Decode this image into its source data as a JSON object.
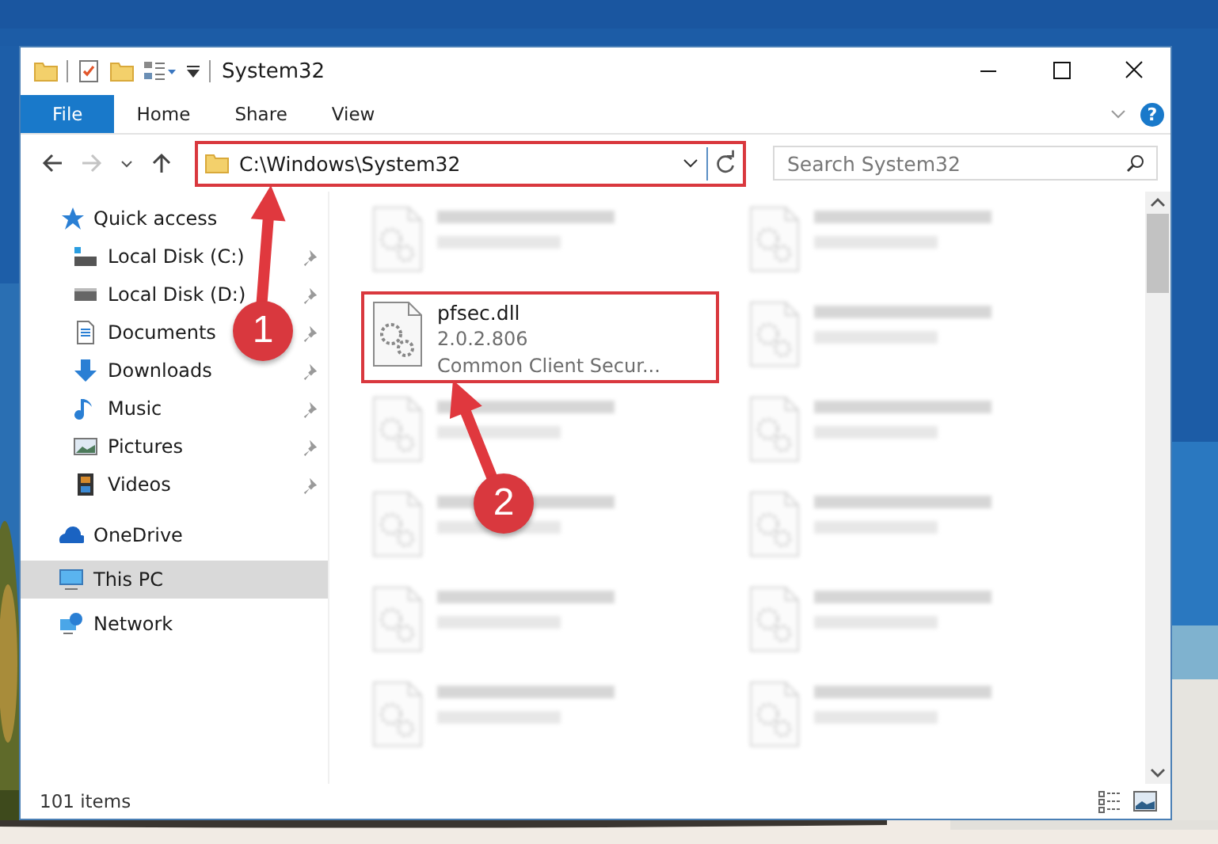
{
  "window": {
    "title": "System32"
  },
  "ribbon": {
    "tabs": [
      {
        "label": "File",
        "selected": true
      },
      {
        "label": "Home",
        "selected": false
      },
      {
        "label": "Share",
        "selected": false
      },
      {
        "label": "View",
        "selected": false
      }
    ],
    "help": "?"
  },
  "address": {
    "path": "C:\\Windows\\System32",
    "highlighted": true,
    "forward_disabled": true
  },
  "search": {
    "placeholder": "Search System32"
  },
  "sidebar": {
    "items": [
      {
        "label": "Quick access",
        "kind": "quick",
        "pinned": false,
        "selected": false,
        "group": true
      },
      {
        "label": "Local Disk (C:)",
        "kind": "system-disk",
        "pinned": true,
        "selected": false,
        "group": false
      },
      {
        "label": "Local Disk (D:)",
        "kind": "disk",
        "pinned": true,
        "selected": false,
        "group": false
      },
      {
        "label": "Documents",
        "kind": "documents",
        "pinned": true,
        "selected": false,
        "group": false
      },
      {
        "label": "Downloads",
        "kind": "downloads",
        "pinned": true,
        "selected": false,
        "group": false
      },
      {
        "label": "Music",
        "kind": "music",
        "pinned": true,
        "selected": false,
        "group": false
      },
      {
        "label": "Pictures",
        "kind": "pictures",
        "pinned": true,
        "selected": false,
        "group": false
      },
      {
        "label": "Videos",
        "kind": "videos",
        "pinned": true,
        "selected": false,
        "group": false
      },
      {
        "label": "OneDrive",
        "kind": "cloud",
        "pinned": false,
        "selected": false,
        "group": true
      },
      {
        "label": "This PC",
        "kind": "pc",
        "pinned": false,
        "selected": true,
        "group": true
      },
      {
        "label": "Network",
        "kind": "network",
        "pinned": false,
        "selected": false,
        "group": true
      }
    ]
  },
  "files": [
    {
      "blurred": true,
      "highlighted": false
    },
    {
      "blurred": true,
      "highlighted": false
    },
    {
      "name": "pfsec.dll",
      "lines": [
        "2.0.2.806",
        "Common Client Secur..."
      ],
      "blurred": false,
      "highlighted": true
    },
    {
      "blurred": true,
      "highlighted": false
    },
    {
      "blurred": true,
      "highlighted": false
    },
    {
      "blurred": true,
      "highlighted": false
    },
    {
      "blurred": true,
      "highlighted": false
    },
    {
      "blurred": true,
      "highlighted": false
    },
    {
      "blurred": true,
      "highlighted": false
    },
    {
      "blurred": true,
      "highlighted": false
    },
    {
      "blurred": true,
      "highlighted": false
    },
    {
      "blurred": true,
      "highlighted": false
    }
  ],
  "status_bar": {
    "count": "101 items"
  },
  "annotations": [
    {
      "label": "1"
    },
    {
      "label": "2"
    }
  ]
}
